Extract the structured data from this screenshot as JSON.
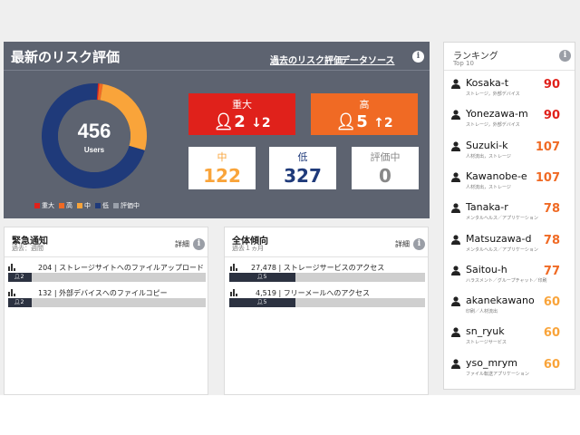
{
  "risk": {
    "title": "最新のリスク評価",
    "link_past": "過去のリスク評価",
    "link_source": "データソース",
    "total": "456",
    "total_label": "Users",
    "critical": {
      "label": "重大",
      "count": "2",
      "change": "2"
    },
    "high": {
      "label": "高",
      "count": "5",
      "change": "2"
    },
    "medium": {
      "label": "中",
      "count": "122"
    },
    "low": {
      "label": "低",
      "count": "327"
    },
    "evaluating": {
      "label": "評価中",
      "count": "0"
    },
    "legend": [
      "重大",
      "高",
      "中",
      "低",
      "評価中"
    ],
    "colors": {
      "critical": "#e0211b",
      "high": "#f06a24",
      "medium": "#f9a43a",
      "low": "#1f3a7a",
      "evaluating": "#9aa0aa"
    }
  },
  "urgent": {
    "title": "緊急通知",
    "sub": "過去：週間",
    "detail": "詳細",
    "rows": [
      {
        "count": "204",
        "text": "ストレージサイトへのファイルアップロード",
        "users": "2",
        "fill": 0.12
      },
      {
        "count": "132",
        "text": "外部デバイスへのファイルコピー",
        "users": "2",
        "fill": 0.12
      }
    ]
  },
  "trend": {
    "title": "全体傾向",
    "sub": "過去１ヵ月",
    "detail": "詳細",
    "rows": [
      {
        "count": "27,478",
        "text": "ストレージサービスのアクセス",
        "users": "5",
        "fill": 0.34
      },
      {
        "count": "4,519",
        "text": "フリーメールへのアクセス",
        "users": "5",
        "fill": 0.34
      }
    ]
  },
  "ranking": {
    "title": "ランキング",
    "sub": "Top 10",
    "items": [
      {
        "name": "Kosaka-t",
        "desc": "ストレージ，外部デバイス",
        "score": "90",
        "color": "#e0211b"
      },
      {
        "name": "Yonezawa-m",
        "desc": "ストレージ，外部デバイス",
        "score": "90",
        "color": "#e0211b"
      },
      {
        "name": "Suzuki-k",
        "desc": "人材流出，ストレージ",
        "score": "107",
        "color": "#f06a24"
      },
      {
        "name": "Kawanobe-e",
        "desc": "人材流出，ストレージ",
        "score": "107",
        "color": "#f06a24"
      },
      {
        "name": "Tanaka-r",
        "desc": "メンタルヘルス／アプリケーション",
        "score": "78",
        "color": "#f06a24"
      },
      {
        "name": "Matsuzawa-d",
        "desc": "メンタルヘルス／アプリケーション",
        "score": "78",
        "color": "#f06a24"
      },
      {
        "name": "Saitou-h",
        "desc": "ハラスメント／グループチャット／印刷",
        "score": "77",
        "color": "#f06a24"
      },
      {
        "name": "akanekawano",
        "desc": "印刷／人材流出",
        "score": "60",
        "color": "#f9a43a"
      },
      {
        "name": "sn_ryuk",
        "desc": "ストレージサービス",
        "score": "60",
        "color": "#f9a43a"
      },
      {
        "name": "yso_mrym",
        "desc": "ファイル転送アプリケーション",
        "score": "60",
        "color": "#f9a43a"
      }
    ]
  }
}
